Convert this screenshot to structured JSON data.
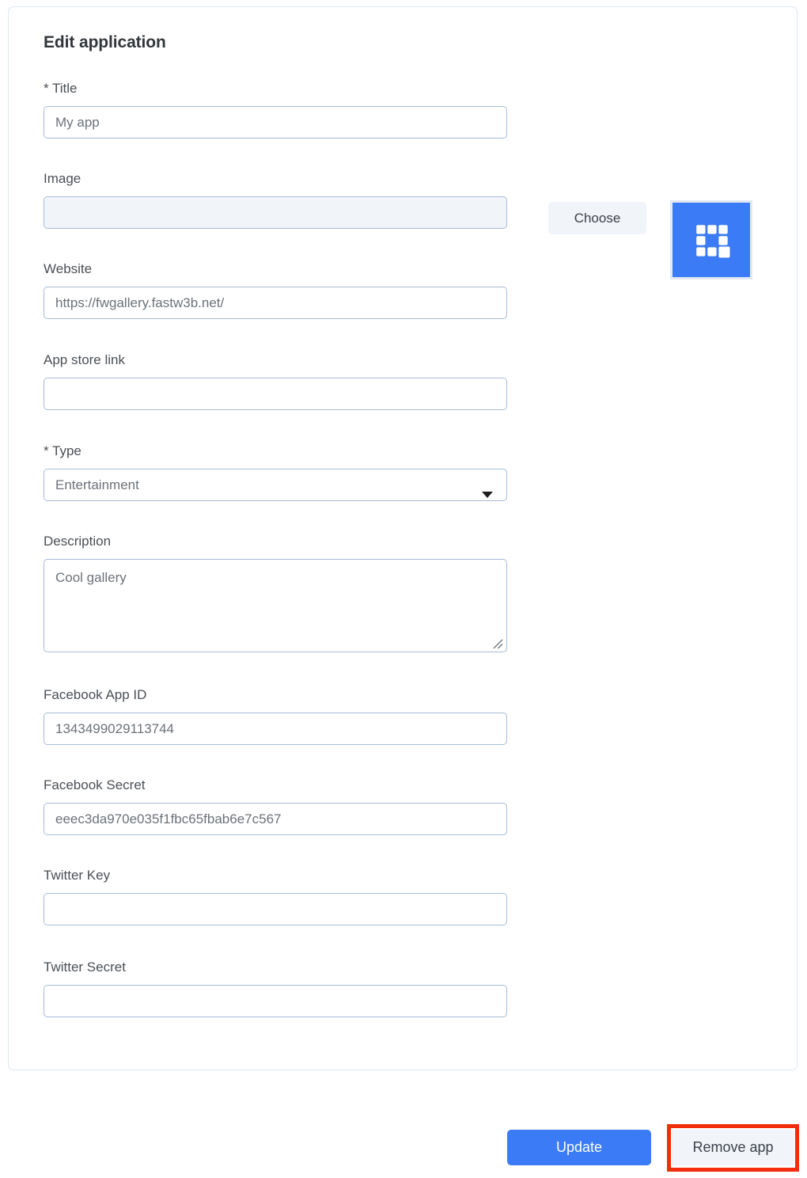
{
  "card": {
    "title": "Edit application"
  },
  "fields": {
    "title": {
      "label": "* Title",
      "value": "My app"
    },
    "image": {
      "label": "Image",
      "value": "",
      "choose_label": "Choose",
      "icon_name": "app-grid-icon",
      "icon_bg": "#3b7bf6"
    },
    "website": {
      "label": "Website",
      "value": "https://fwgallery.fastw3b.net/"
    },
    "app_store_link": {
      "label": "App store link",
      "value": ""
    },
    "type": {
      "label": "* Type",
      "value": "Entertainment"
    },
    "description": {
      "label": "Description",
      "value": "Cool gallery"
    },
    "facebook_app_id": {
      "label": "Facebook App ID",
      "value": "1343499029113744"
    },
    "facebook_secret": {
      "label": "Facebook Secret",
      "value": "eeec3da970e035f1fbc65fbab6e7c567"
    },
    "twitter_key": {
      "label": "Twitter Key",
      "value": ""
    },
    "twitter_secret": {
      "label": "Twitter Secret",
      "value": ""
    }
  },
  "footer": {
    "update_label": "Update",
    "remove_label": "Remove app",
    "highlight_color": "#f22d0d",
    "primary_color": "#3b7bf6"
  }
}
